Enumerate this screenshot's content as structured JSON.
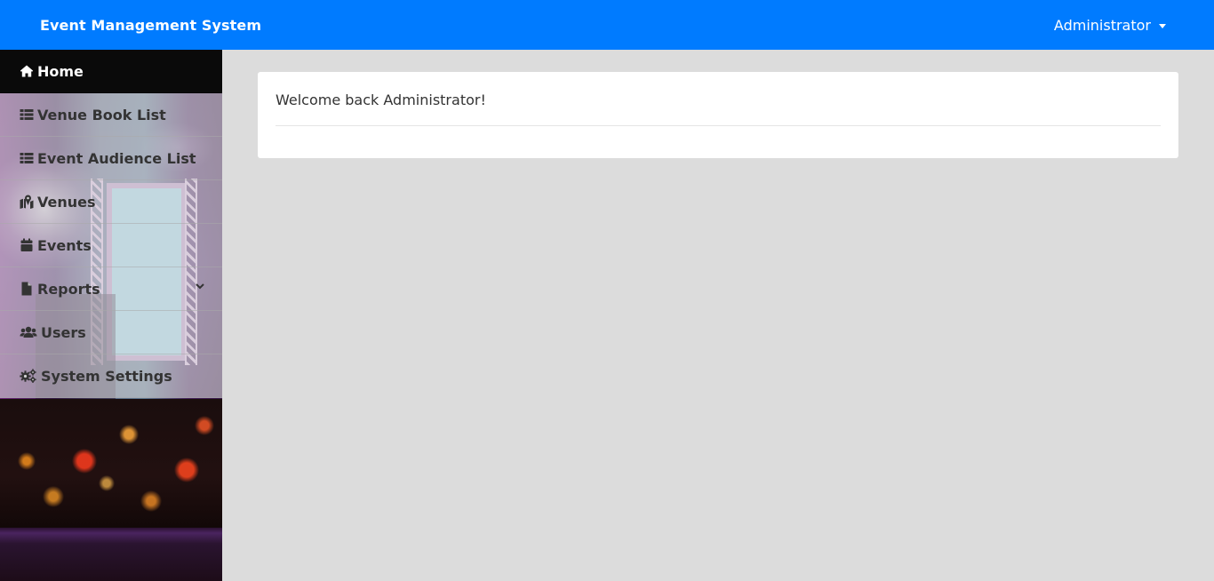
{
  "navbar": {
    "brand": "Event Management System",
    "user": "Administrator",
    "color": "#007bff"
  },
  "sidebar": {
    "items": [
      {
        "label": "Home",
        "icon": "home-icon",
        "active": true
      },
      {
        "label": "Venue Book List",
        "icon": "list-icon"
      },
      {
        "label": "Event Audience List",
        "icon": "list-icon"
      },
      {
        "label": "Venues",
        "icon": "map-marked-icon"
      },
      {
        "label": "Events",
        "icon": "calendar-icon"
      },
      {
        "label": "Reports",
        "icon": "file-icon",
        "has_submenu": true,
        "chevron_icon": "chevron-down-icon"
      },
      {
        "label": "Users",
        "icon": "users-icon"
      },
      {
        "label": "System Settings",
        "icon": "cogs-icon"
      }
    ]
  },
  "main": {
    "welcome_text": "Welcome back Administrator!"
  }
}
